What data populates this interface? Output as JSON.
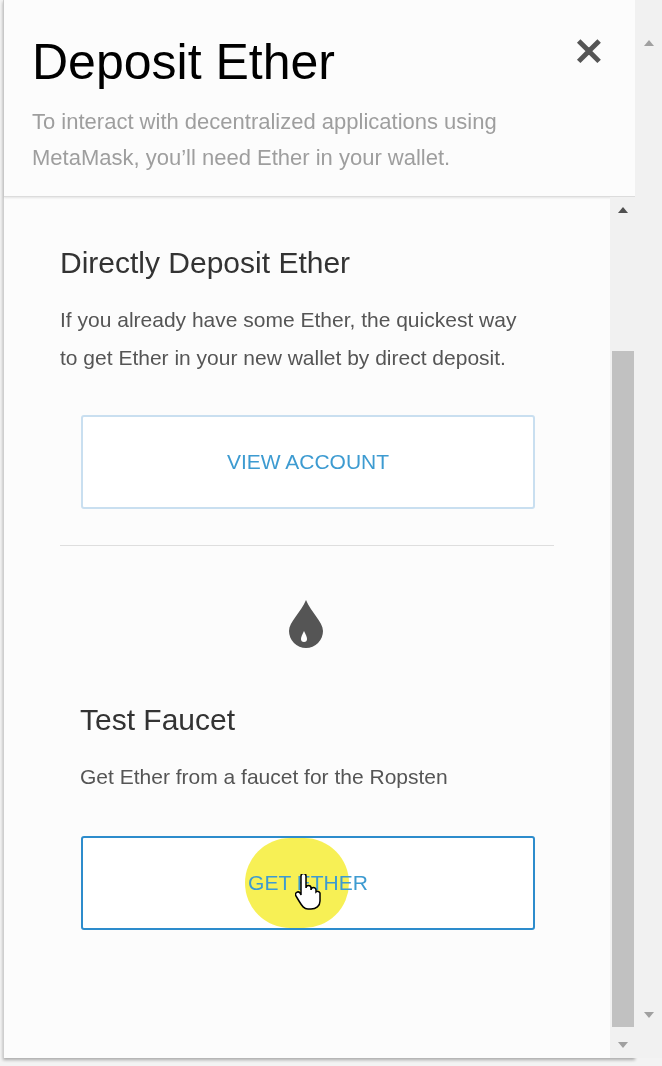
{
  "dialog": {
    "title": "Deposit Ether",
    "close": "✕",
    "subtitle": "To interact with decentralized applications using MetaMask, you’ll need Ether in your wallet."
  },
  "sections": [
    {
      "kind": "direct",
      "title": "Directly Deposit Ether",
      "text": "If you already have some Ether, the quickest way to get Ether in your new wallet by direct deposit.",
      "button": {
        "label": "VIEW ACCOUNT",
        "focused": false
      }
    },
    {
      "kind": "faucet",
      "title": "Test Faucet",
      "text": "Get Ether from a faucet for the Ropsten",
      "button": {
        "label": "GET ETHER",
        "focused": true
      }
    }
  ]
}
